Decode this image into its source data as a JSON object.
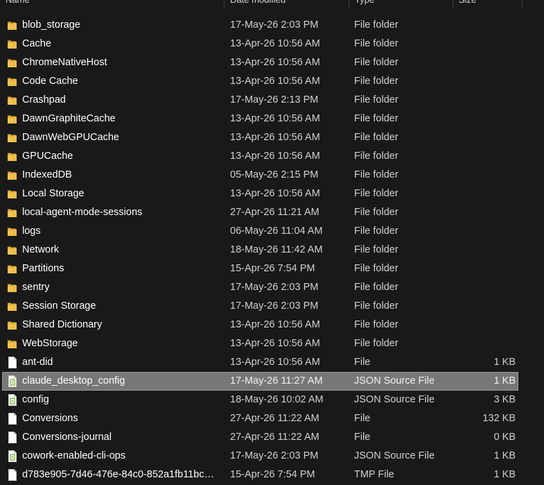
{
  "columns": {
    "name": "Name",
    "date": "Date modified",
    "type": "Type",
    "size": "Size"
  },
  "colors": {
    "background": "#191919",
    "folder": "#f0c24f",
    "selection": "#777777",
    "json_icon_accent": "#8fb043"
  },
  "selected_index": 20,
  "files": [
    {
      "name": "blob_storage",
      "date": "17-May-26 2:03 PM",
      "type": "File folder",
      "size": "",
      "icon": "folder-icon"
    },
    {
      "name": "Cache",
      "date": "13-Apr-26 10:56 AM",
      "type": "File folder",
      "size": "",
      "icon": "folder-icon"
    },
    {
      "name": "ChromeNativeHost",
      "date": "13-Apr-26 10:56 AM",
      "type": "File folder",
      "size": "",
      "icon": "folder-icon"
    },
    {
      "name": "Code Cache",
      "date": "13-Apr-26 10:56 AM",
      "type": "File folder",
      "size": "",
      "icon": "folder-icon"
    },
    {
      "name": "Crashpad",
      "date": "17-May-26 2:13 PM",
      "type": "File folder",
      "size": "",
      "icon": "folder-icon"
    },
    {
      "name": "DawnGraphiteCache",
      "date": "13-Apr-26 10:56 AM",
      "type": "File folder",
      "size": "",
      "icon": "folder-icon"
    },
    {
      "name": "DawnWebGPUCache",
      "date": "13-Apr-26 10:56 AM",
      "type": "File folder",
      "size": "",
      "icon": "folder-icon"
    },
    {
      "name": "GPUCache",
      "date": "13-Apr-26 10:56 AM",
      "type": "File folder",
      "size": "",
      "icon": "folder-icon"
    },
    {
      "name": "IndexedDB",
      "date": "05-May-26 2:15 PM",
      "type": "File folder",
      "size": "",
      "icon": "folder-icon"
    },
    {
      "name": "Local Storage",
      "date": "13-Apr-26 10:56 AM",
      "type": "File folder",
      "size": "",
      "icon": "folder-icon"
    },
    {
      "name": "local-agent-mode-sessions",
      "date": "27-Apr-26 11:21 AM",
      "type": "File folder",
      "size": "",
      "icon": "folder-icon"
    },
    {
      "name": "logs",
      "date": "06-May-26 11:04 AM",
      "type": "File folder",
      "size": "",
      "icon": "folder-icon"
    },
    {
      "name": "Network",
      "date": "18-May-26 11:42 AM",
      "type": "File folder",
      "size": "",
      "icon": "folder-icon"
    },
    {
      "name": "Partitions",
      "date": "15-Apr-26 7:54 PM",
      "type": "File folder",
      "size": "",
      "icon": "folder-icon"
    },
    {
      "name": "sentry",
      "date": "17-May-26 2:03 PM",
      "type": "File folder",
      "size": "",
      "icon": "folder-icon"
    },
    {
      "name": "Session Storage",
      "date": "17-May-26 2:03 PM",
      "type": "File folder",
      "size": "",
      "icon": "folder-icon"
    },
    {
      "name": "Shared Dictionary",
      "date": "13-Apr-26 10:56 AM",
      "type": "File folder",
      "size": "",
      "icon": "folder-icon"
    },
    {
      "name": "WebStorage",
      "date": "13-Apr-26 10:56 AM",
      "type": "File folder",
      "size": "",
      "icon": "folder-icon"
    },
    {
      "name": "ant-did",
      "date": "13-Apr-26 10:56 AM",
      "type": "File",
      "size": "1 KB",
      "icon": "file-icon"
    },
    {
      "name": "claude_desktop_config",
      "date": "17-May-26 11:27 AM",
      "type": "JSON Source File",
      "size": "1 KB",
      "icon": "json-file-icon"
    },
    {
      "name": "config",
      "date": "18-May-26 10:02 AM",
      "type": "JSON Source File",
      "size": "3 KB",
      "icon": "json-file-icon"
    },
    {
      "name": "Conversions",
      "date": "27-Apr-26 11:22 AM",
      "type": "File",
      "size": "132 KB",
      "icon": "file-icon"
    },
    {
      "name": "Conversions-journal",
      "date": "27-Apr-26 11:22 AM",
      "type": "File",
      "size": "0 KB",
      "icon": "file-icon"
    },
    {
      "name": "cowork-enabled-cli-ops",
      "date": "17-May-26 2:03 PM",
      "type": "JSON Source File",
      "size": "1 KB",
      "icon": "json-file-icon"
    },
    {
      "name": "d783e905-7d46-476e-84c0-852a1fb11bc…",
      "date": "15-Apr-26 7:54 PM",
      "type": "TMP File",
      "size": "1 KB",
      "icon": "file-icon"
    }
  ]
}
